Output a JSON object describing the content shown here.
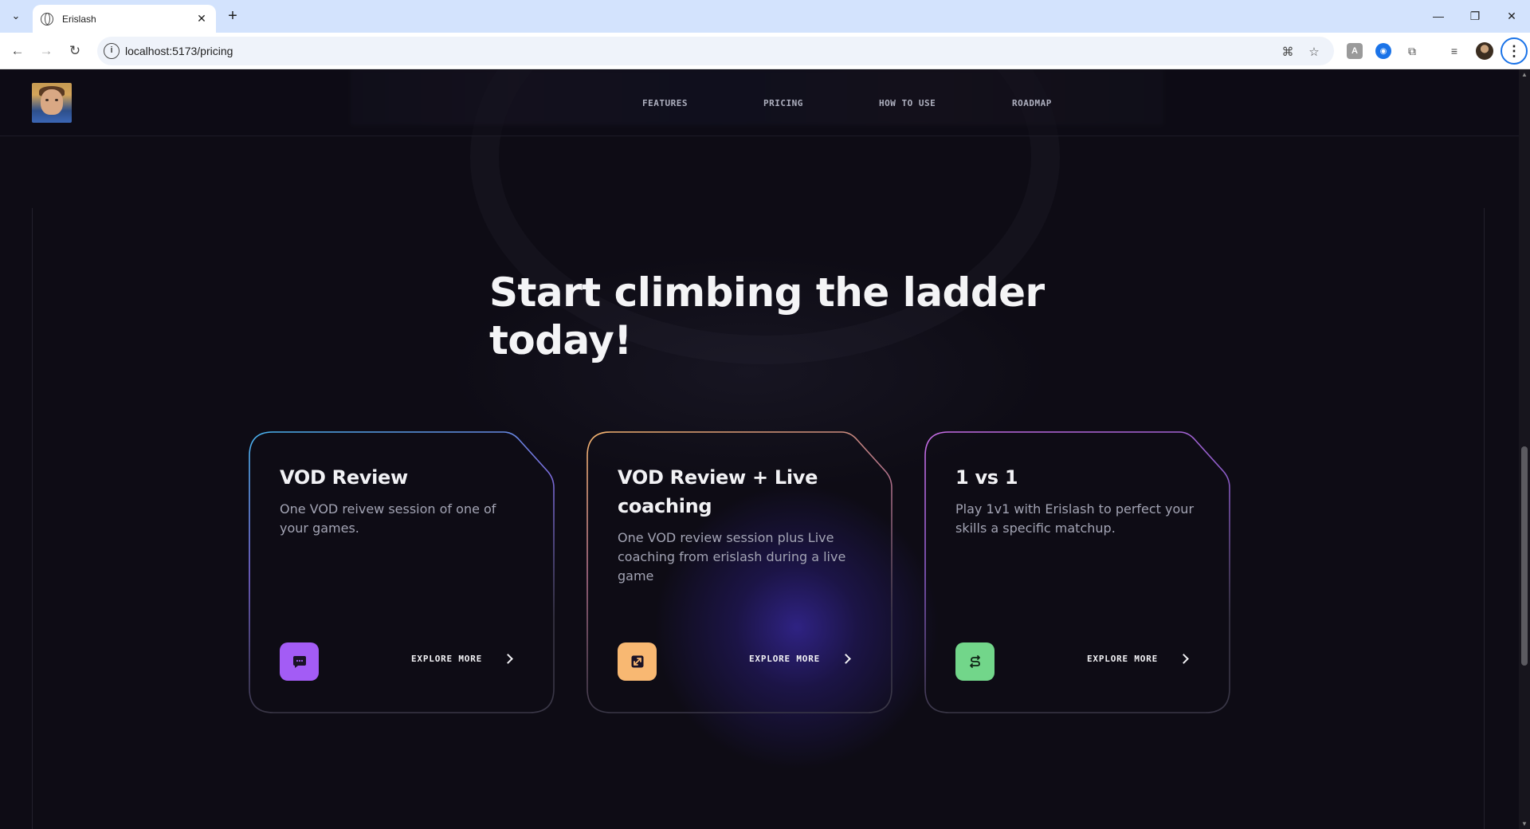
{
  "browser": {
    "tab_title": "Erislash",
    "tab_close": "✕",
    "new_tab": "+",
    "url": "localhost:5173/pricing",
    "site_info_icon": "i",
    "window_controls": {
      "minimize": "—",
      "restore": "❐",
      "close": "✕"
    }
  },
  "header": {
    "logo_alt": "Erislash avatar",
    "nav": [
      {
        "label": "FEATURES"
      },
      {
        "label": "PRICING"
      },
      {
        "label": "HOW TO USE"
      },
      {
        "label": "ROADMAP"
      }
    ]
  },
  "hero": {
    "headline_line1": "Start climbing the ladder",
    "headline_line2": "today!"
  },
  "cards": [
    {
      "title": "VOD Review",
      "description": "One VOD reivew session of one of your games.",
      "cta": "EXPLORE MORE",
      "icon": "chat-bubble-icon",
      "icon_color": "#a35cf5",
      "gradient": [
        "#49b5f0",
        "#7c6cdc",
        "#3a3747"
      ]
    },
    {
      "title": "VOD Review + Live coaching",
      "description": "One VOD review session plus Live coaching from erislash during a live game",
      "cta": "EXPLORE MORE",
      "icon": "resize-arrows-icon",
      "icon_color": "#f8b872",
      "gradient": [
        "#f6b56f",
        "#b0708a",
        "#3a3747"
      ]
    },
    {
      "title": "1 vs 1",
      "description": "Play 1v1 with Erislash to perfect your skills a specific matchup.",
      "cta": "EXPLORE MORE",
      "icon": "swap-arrows-icon",
      "icon_color": "#72d68a",
      "gradient": [
        "#c86de6",
        "#8b5cc8",
        "#3a3747"
      ]
    }
  ]
}
